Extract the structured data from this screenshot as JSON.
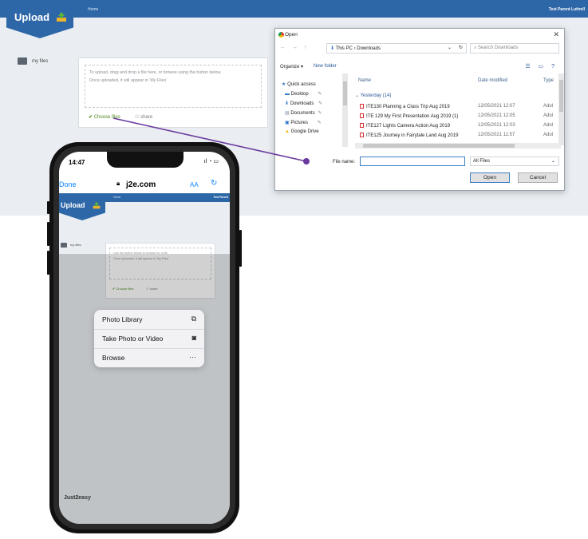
{
  "desktop": {
    "topbar": {
      "home": "Home",
      "user": "Test Parent Luttrell"
    },
    "upload_label": "Upload",
    "sidebar_item": "my files",
    "dropzone": {
      "line1": "To upload, drag and drop a file here, or browse using the button below.",
      "line2": "Once uploaded, it will appear in 'My Files'"
    },
    "choose_files": "Choose files",
    "share": "share"
  },
  "dialog": {
    "title": "Open",
    "breadcrumb": "This PC  ›  Downloads",
    "search_placeholder": "Search Downloads",
    "organize": "Organize ▾",
    "new_folder": "New folder",
    "nav": [
      {
        "label": "Quick access",
        "icon": "star-icon"
      },
      {
        "label": "Desktop",
        "icon": "desktop-icon"
      },
      {
        "label": "Downloads",
        "icon": "download-icon"
      },
      {
        "label": "Documents",
        "icon": "documents-icon"
      },
      {
        "label": "Pictures",
        "icon": "pictures-icon"
      },
      {
        "label": "Google Drive",
        "icon": "google-drive-icon"
      }
    ],
    "columns": {
      "name": "Name",
      "date": "Date modified",
      "type": "Type"
    },
    "group": "Yesterday (14)",
    "files": [
      {
        "name": "ITE130 Planning a Class Trip Aug 2019",
        "date": "12/05/2021 12:07",
        "type": "Adol"
      },
      {
        "name": "ITE 129 My First Presentation Aug 2019 (1)",
        "date": "12/05/2021 12:05",
        "type": "Adol"
      },
      {
        "name": "ITE127 Lights Camera Action Aug 2019",
        "date": "12/05/2021 12:03",
        "type": "Adol"
      },
      {
        "name": "ITE125 Journey in Fairytale Land Aug 2019",
        "date": "12/05/2021 11:57",
        "type": "Adol"
      }
    ],
    "file_name_label": "File name:",
    "file_name_value": "",
    "filter": "All Files",
    "open": "Open",
    "cancel": "Cancel"
  },
  "phone": {
    "time": "14:47",
    "done": "Done",
    "url": "j2e.com",
    "aa": "AA",
    "upload_label": "Upload",
    "home": "Home",
    "user": "Test Parent",
    "sidebar_item": "my files",
    "dropzone": {
      "line1": "Use the button below to browse for a file.",
      "line2": "Once uploaded, it will appear in 'My Files'"
    },
    "choose_files": "Choose files",
    "share": "share",
    "menu": [
      {
        "label": "Photo Library",
        "icon": "photo-library-icon"
      },
      {
        "label": "Take Photo or Video",
        "icon": "camera-icon"
      },
      {
        "label": "Browse",
        "icon": "more-icon"
      }
    ],
    "footer_logo": "Just2easy"
  },
  "colors": {
    "brand_blue": "#2e67a8",
    "accent_green": "#4d8a1c",
    "connector_purple": "#6a3a9e",
    "ios_blue": "#0a84ff"
  }
}
